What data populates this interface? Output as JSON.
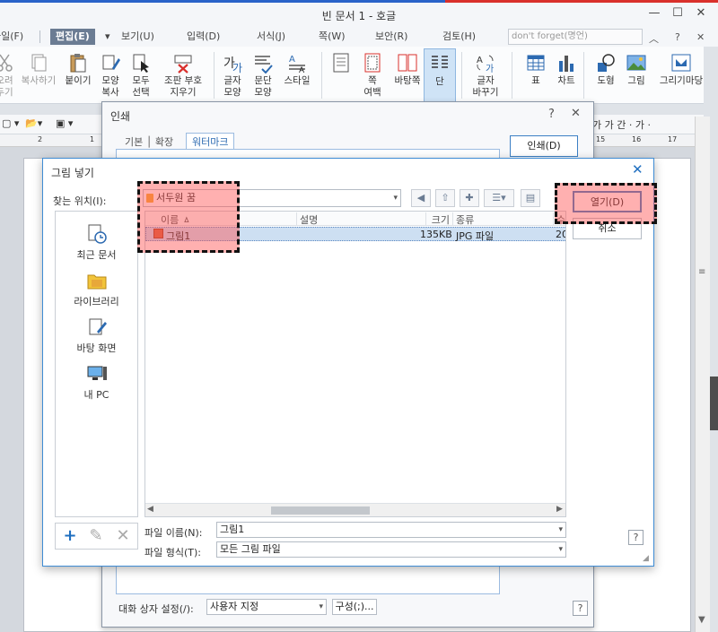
{
  "app": {
    "title": "빈 문서 1 - 호글",
    "window_controls": [
      "—",
      "☐",
      "✕"
    ]
  },
  "menubar": {
    "items": [
      "파일(F)",
      "편집(E)",
      "보기(U)",
      "입력(D)",
      "서식(J)",
      "쪽(W)",
      "보안(R)",
      "검토(H)"
    ],
    "active_index": 1,
    "search_text": "don't forget(명언)",
    "extras": [
      "︿",
      "?",
      "✕"
    ]
  },
  "ribbon": {
    "buttons": [
      {
        "label": "오려\n두기",
        "icon": "scissors-icon"
      },
      {
        "label": "복사하기",
        "icon": "copy-icon"
      },
      {
        "label": "붙이기",
        "icon": "paste-icon"
      },
      {
        "label": "모양\n복사",
        "icon": "format-copy-icon"
      },
      {
        "label": "모두\n선택",
        "icon": "select-all-icon"
      },
      {
        "label": "조판 부호\n지우기",
        "icon": "clear-format-icon"
      },
      {
        "label": "글자\n모양",
        "icon": "char-shape-icon"
      },
      {
        "label": "문단\n모양",
        "icon": "para-shape-icon"
      },
      {
        "label": "스타일",
        "icon": "style-icon"
      },
      {
        "label": "쪽\n여백",
        "icon": "page-margin-icon"
      },
      {
        "label": "바탕쪽",
        "icon": "master-page-icon"
      },
      {
        "label": "단",
        "icon": "columns-icon"
      },
      {
        "label": "글자\n바꾸기",
        "icon": "replace-char-icon"
      },
      {
        "label": "표",
        "icon": "table-icon"
      },
      {
        "label": "차트",
        "icon": "chart-icon"
      },
      {
        "label": "도형",
        "icon": "shape-icon"
      },
      {
        "label": "그림",
        "icon": "picture-icon"
      },
      {
        "label": "그리기마당",
        "icon": "clipart-icon"
      }
    ]
  },
  "formatbar": {
    "right_text": "가 가 간 · 가 ·"
  },
  "ruler": {
    "left_marks": [
      "2",
      "1"
    ],
    "right_marks": [
      "15",
      "16",
      "17"
    ]
  },
  "print_dialog": {
    "title": "인쇄",
    "tabs": "기본 │ 확장",
    "active_tab": "워터마크",
    "print_button": "인쇄(D)",
    "footer_label": "대화 상자 설정(/):",
    "footer_value": "사용자 지정",
    "config_button": "구성(;)...",
    "help": "?",
    "close": "✕"
  },
  "picture_dialog": {
    "title": "그림 넣기",
    "close": "✕",
    "look_in_label": "찾는 위치(I):",
    "look_in_value": "서두원 꿈",
    "places": [
      {
        "label": "최근 문서",
        "icon": "recent-docs-icon"
      },
      {
        "label": "라이브러리",
        "icon": "library-icon"
      },
      {
        "label": "바탕 화면",
        "icon": "desktop-icon"
      },
      {
        "label": "내 PC",
        "icon": "my-pc-icon"
      }
    ],
    "columns": [
      "이름 ㅿ",
      "설명",
      "크기",
      "종류",
      "수"
    ],
    "files": [
      {
        "name": "그림1",
        "size": "135KB",
        "type": "JPG 파일",
        "date": "20"
      }
    ],
    "open_button": "열기(D)",
    "cancel_button": "취소",
    "filename_label": "파일 이름(N):",
    "filename_value": "그림1",
    "filetype_label": "파일 형식(T):",
    "filetype_value": "모든 그림 파일",
    "help": "?"
  },
  "colors": {
    "accent": "#3f8cd4",
    "highlight_fill": "#ff5050",
    "selected_row": "#cddff2"
  }
}
